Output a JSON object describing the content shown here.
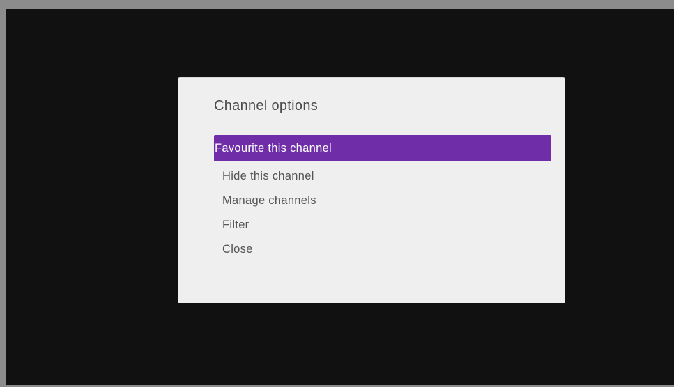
{
  "dialog": {
    "title": "Channel options",
    "menu": {
      "items": [
        {
          "label": "Favourite this channel",
          "selected": true
        },
        {
          "label": "Hide this channel",
          "selected": false
        },
        {
          "label": "Manage channels",
          "selected": false
        },
        {
          "label": "Filter",
          "selected": false
        },
        {
          "label": "Close",
          "selected": false
        }
      ]
    }
  },
  "colors": {
    "screen_background": "#111111",
    "dialog_background": "#efefef",
    "highlight": "#6f2da8",
    "highlight_text": "#ffffff",
    "text": "#555555"
  }
}
